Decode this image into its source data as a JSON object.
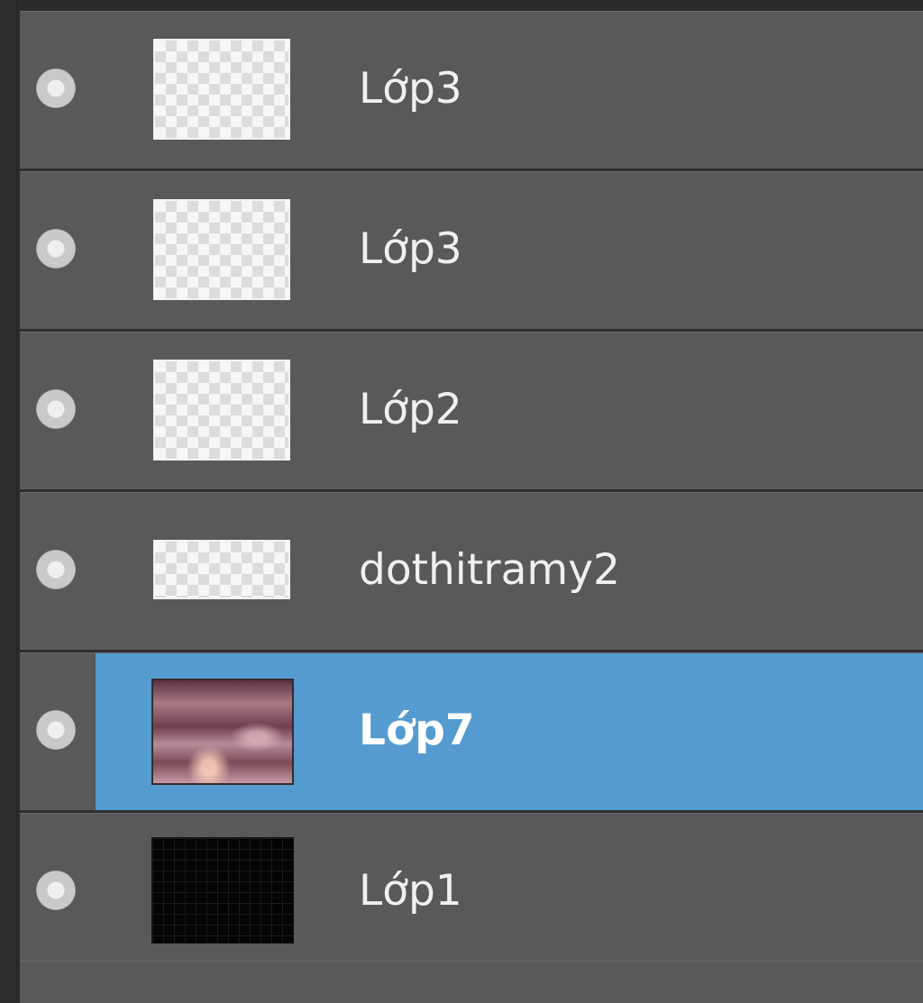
{
  "layers_panel": {
    "layers": [
      {
        "name": "Lớp3",
        "thumbnail": "transparent-thumbnail",
        "selected": false
      },
      {
        "name": "Lớp3",
        "thumbnail": "transparent-thumbnail",
        "selected": false
      },
      {
        "name": "Lớp2",
        "thumbnail": "transparent-thumbnail",
        "selected": false
      },
      {
        "name": "dothitramy2",
        "thumbnail": "transparent-wide-thumbnail",
        "selected": false
      },
      {
        "name": "Lớp7",
        "thumbnail": "photo-thumbnail",
        "selected": true
      },
      {
        "name": "Lớp1",
        "thumbnail": "black-thumbnail",
        "selected": false
      }
    ],
    "colors": {
      "row_bg": "#595959",
      "selected_bg": "#549bd0",
      "divider": "#2f2f2f",
      "text": "#f0f0f0"
    },
    "icons": {
      "visibility": "visibility-dot-icon"
    }
  }
}
